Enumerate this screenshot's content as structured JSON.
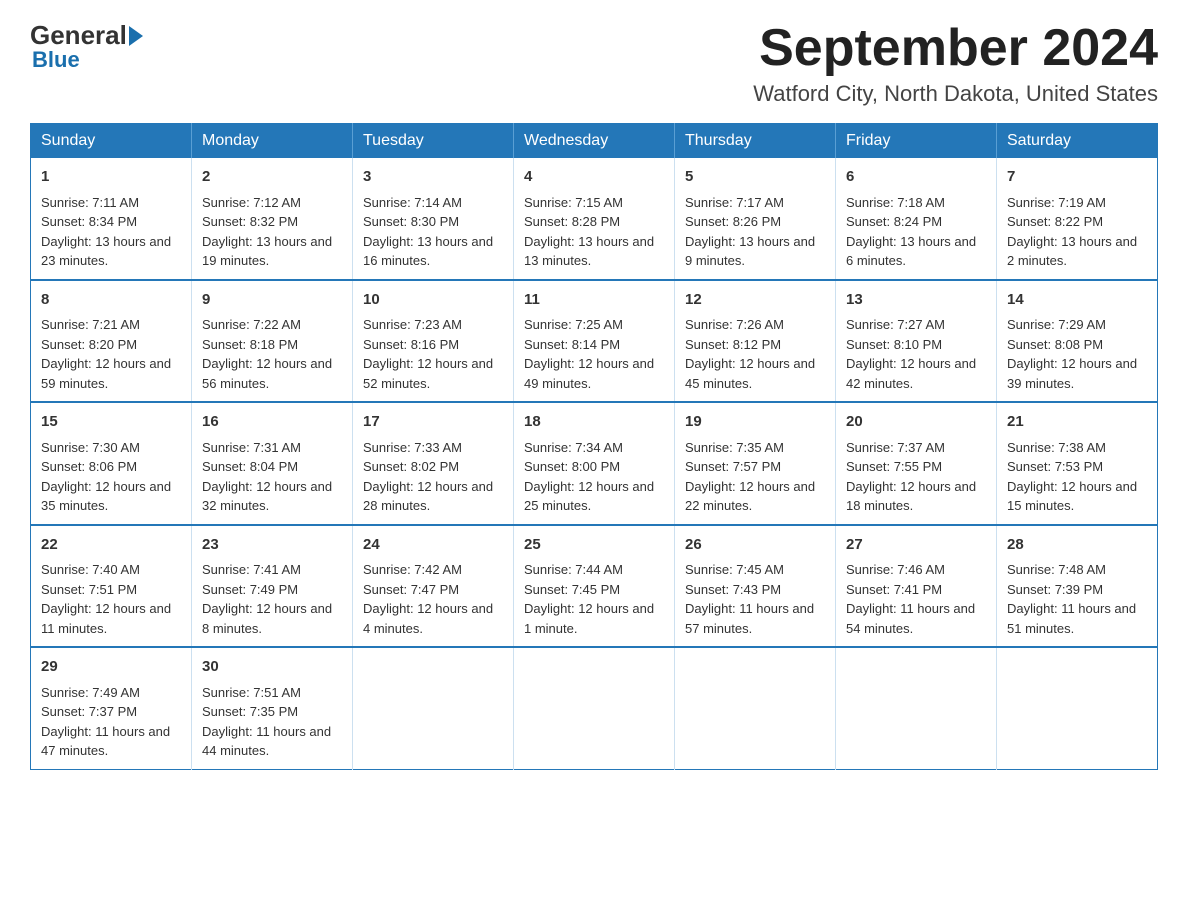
{
  "logo": {
    "text_general": "General",
    "text_blue": "Blue"
  },
  "title": {
    "month_year": "September 2024",
    "location": "Watford City, North Dakota, United States"
  },
  "days_of_week": [
    "Sunday",
    "Monday",
    "Tuesday",
    "Wednesday",
    "Thursday",
    "Friday",
    "Saturday"
  ],
  "weeks": [
    [
      {
        "day": "1",
        "sunrise": "7:11 AM",
        "sunset": "8:34 PM",
        "daylight": "13 hours and 23 minutes."
      },
      {
        "day": "2",
        "sunrise": "7:12 AM",
        "sunset": "8:32 PM",
        "daylight": "13 hours and 19 minutes."
      },
      {
        "day": "3",
        "sunrise": "7:14 AM",
        "sunset": "8:30 PM",
        "daylight": "13 hours and 16 minutes."
      },
      {
        "day": "4",
        "sunrise": "7:15 AM",
        "sunset": "8:28 PM",
        "daylight": "13 hours and 13 minutes."
      },
      {
        "day": "5",
        "sunrise": "7:17 AM",
        "sunset": "8:26 PM",
        "daylight": "13 hours and 9 minutes."
      },
      {
        "day": "6",
        "sunrise": "7:18 AM",
        "sunset": "8:24 PM",
        "daylight": "13 hours and 6 minutes."
      },
      {
        "day": "7",
        "sunrise": "7:19 AM",
        "sunset": "8:22 PM",
        "daylight": "13 hours and 2 minutes."
      }
    ],
    [
      {
        "day": "8",
        "sunrise": "7:21 AM",
        "sunset": "8:20 PM",
        "daylight": "12 hours and 59 minutes."
      },
      {
        "day": "9",
        "sunrise": "7:22 AM",
        "sunset": "8:18 PM",
        "daylight": "12 hours and 56 minutes."
      },
      {
        "day": "10",
        "sunrise": "7:23 AM",
        "sunset": "8:16 PM",
        "daylight": "12 hours and 52 minutes."
      },
      {
        "day": "11",
        "sunrise": "7:25 AM",
        "sunset": "8:14 PM",
        "daylight": "12 hours and 49 minutes."
      },
      {
        "day": "12",
        "sunrise": "7:26 AM",
        "sunset": "8:12 PM",
        "daylight": "12 hours and 45 minutes."
      },
      {
        "day": "13",
        "sunrise": "7:27 AM",
        "sunset": "8:10 PM",
        "daylight": "12 hours and 42 minutes."
      },
      {
        "day": "14",
        "sunrise": "7:29 AM",
        "sunset": "8:08 PM",
        "daylight": "12 hours and 39 minutes."
      }
    ],
    [
      {
        "day": "15",
        "sunrise": "7:30 AM",
        "sunset": "8:06 PM",
        "daylight": "12 hours and 35 minutes."
      },
      {
        "day": "16",
        "sunrise": "7:31 AM",
        "sunset": "8:04 PM",
        "daylight": "12 hours and 32 minutes."
      },
      {
        "day": "17",
        "sunrise": "7:33 AM",
        "sunset": "8:02 PM",
        "daylight": "12 hours and 28 minutes."
      },
      {
        "day": "18",
        "sunrise": "7:34 AM",
        "sunset": "8:00 PM",
        "daylight": "12 hours and 25 minutes."
      },
      {
        "day": "19",
        "sunrise": "7:35 AM",
        "sunset": "7:57 PM",
        "daylight": "12 hours and 22 minutes."
      },
      {
        "day": "20",
        "sunrise": "7:37 AM",
        "sunset": "7:55 PM",
        "daylight": "12 hours and 18 minutes."
      },
      {
        "day": "21",
        "sunrise": "7:38 AM",
        "sunset": "7:53 PM",
        "daylight": "12 hours and 15 minutes."
      }
    ],
    [
      {
        "day": "22",
        "sunrise": "7:40 AM",
        "sunset": "7:51 PM",
        "daylight": "12 hours and 11 minutes."
      },
      {
        "day": "23",
        "sunrise": "7:41 AM",
        "sunset": "7:49 PM",
        "daylight": "12 hours and 8 minutes."
      },
      {
        "day": "24",
        "sunrise": "7:42 AM",
        "sunset": "7:47 PM",
        "daylight": "12 hours and 4 minutes."
      },
      {
        "day": "25",
        "sunrise": "7:44 AM",
        "sunset": "7:45 PM",
        "daylight": "12 hours and 1 minute."
      },
      {
        "day": "26",
        "sunrise": "7:45 AM",
        "sunset": "7:43 PM",
        "daylight": "11 hours and 57 minutes."
      },
      {
        "day": "27",
        "sunrise": "7:46 AM",
        "sunset": "7:41 PM",
        "daylight": "11 hours and 54 minutes."
      },
      {
        "day": "28",
        "sunrise": "7:48 AM",
        "sunset": "7:39 PM",
        "daylight": "11 hours and 51 minutes."
      }
    ],
    [
      {
        "day": "29",
        "sunrise": "7:49 AM",
        "sunset": "7:37 PM",
        "daylight": "11 hours and 47 minutes."
      },
      {
        "day": "30",
        "sunrise": "7:51 AM",
        "sunset": "7:35 PM",
        "daylight": "11 hours and 44 minutes."
      },
      null,
      null,
      null,
      null,
      null
    ]
  ]
}
